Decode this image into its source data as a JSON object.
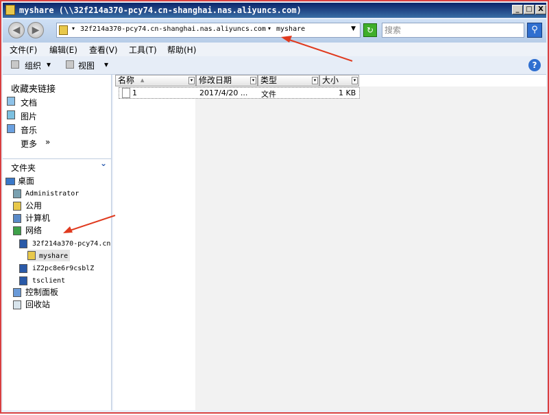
{
  "window": {
    "title": "myshare (\\\\32f214a370-pcy74.cn-shanghai.nas.aliyuncs.com)",
    "min_label": "_",
    "max_label": "□",
    "close_label": "X"
  },
  "nav": {
    "back_glyph": "◀",
    "forward_glyph": "▶"
  },
  "address": {
    "crumbs": [
      "32f214a370-pcy74.cn-shanghai.nas.aliyuncs.com",
      "myshare"
    ],
    "sep_glyph": "▾",
    "drop_glyph": "▼"
  },
  "refresh_glyph": "↻",
  "search": {
    "placeholder": "搜索",
    "button_glyph": "⚲"
  },
  "menu": [
    "文件(F)",
    "编辑(E)",
    "查看(V)",
    "工具(T)",
    "帮助(H)"
  ],
  "toolbar": {
    "organize_label": "组织",
    "views_label": "视图",
    "drop_glyph": "▾",
    "help_glyph": "?"
  },
  "favorites": {
    "heading": "收藏夹链接",
    "items": [
      "文档",
      "图片",
      "音乐"
    ],
    "more_label": "更多",
    "more_glyph": "»"
  },
  "folders": {
    "heading": "文件夹",
    "chevron_glyph": "⌄",
    "tree": [
      "桌面",
      "Administrator",
      "公用",
      "计算机",
      "网络",
      "32f214a370-pcy74.cn",
      "myshare",
      "iZ2pc8e6r9csblZ",
      "tsclient",
      "控制面板",
      "回收站"
    ]
  },
  "columns": [
    {
      "label": "名称",
      "sort_glyph": "▲"
    },
    {
      "label": "修改日期"
    },
    {
      "label": "类型"
    },
    {
      "label": "大小"
    }
  ],
  "col_drop_glyph": "▾",
  "files": [
    {
      "name": "1",
      "modified": "2017/4/20 ...",
      "type": "文件",
      "size": "1 KB"
    }
  ],
  "colors": {
    "accent": "#0a246a",
    "annotation": "#e03a1e"
  }
}
